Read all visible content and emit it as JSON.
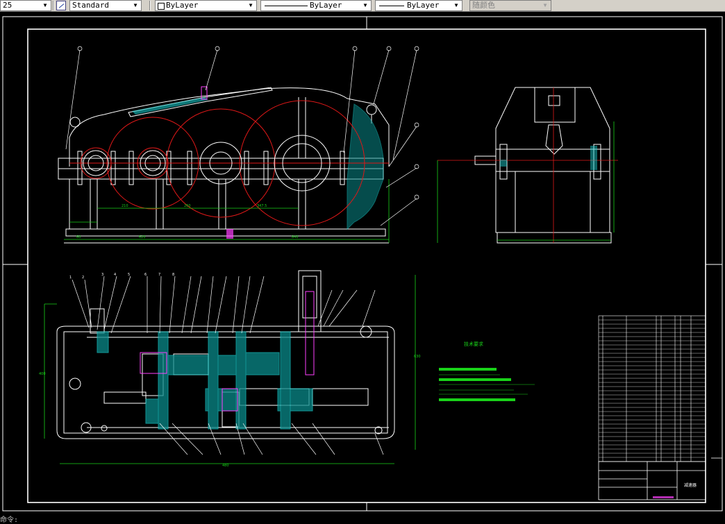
{
  "toolbar": {
    "scale_value": "25",
    "text_style": "Standard",
    "layer": "ByLayer",
    "linetype": "ByLayer",
    "lineweight": "ByLayer",
    "plot_style": "随颜色"
  },
  "drawing": {
    "tech_req_title": "技术要求",
    "title_block_name": "减速器"
  },
  "command_line": "命令:"
}
